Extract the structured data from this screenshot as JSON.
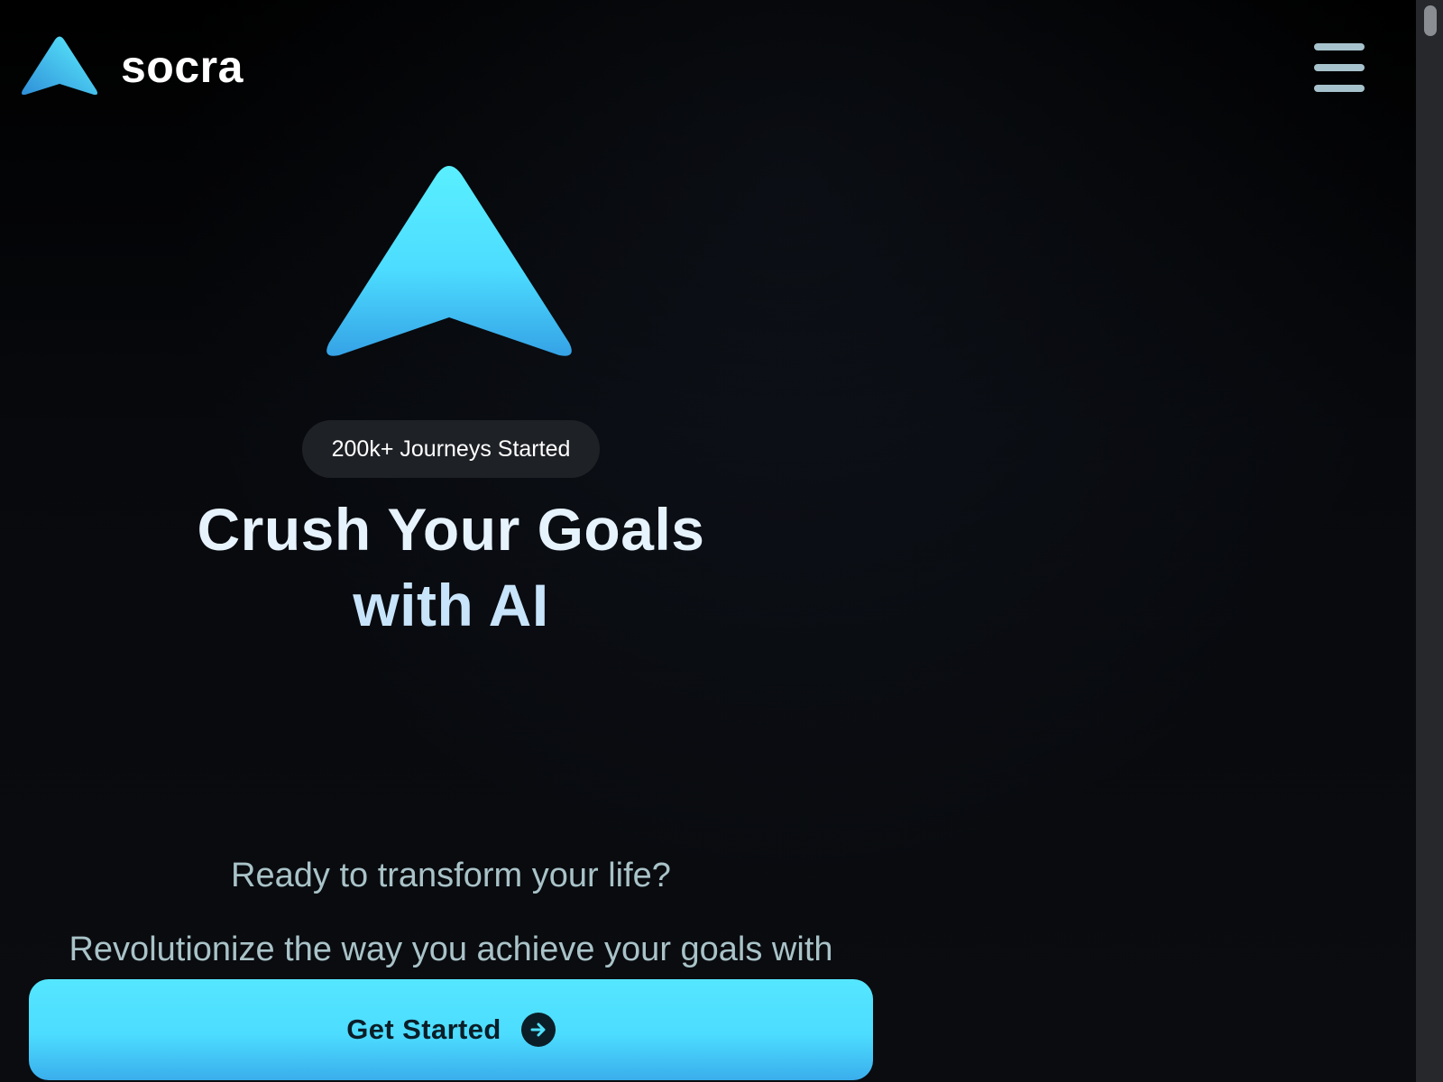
{
  "header": {
    "brand_name": "socra",
    "logo_icon": "arrow-triangle-logo-icon",
    "menu_icon": "hamburger-menu-icon"
  },
  "hero": {
    "badge_text": "200k+ Journeys Started",
    "headline_line1": "Crush Your Goals",
    "headline_line2": "with AI",
    "tagline": "Ready to transform your life?",
    "subtitle": "Revolutionize the way you achieve your goals with socra.",
    "cta_label": "Get Started",
    "cta_icon": "arrow-right-circle-icon"
  },
  "colors": {
    "background": "#07080b",
    "accent_light": "#55e6ff",
    "accent_dark": "#3aaeec",
    "text_primary": "#ffffff",
    "text_muted": "#a9c3c8",
    "badge_bg": "#1e2126"
  }
}
